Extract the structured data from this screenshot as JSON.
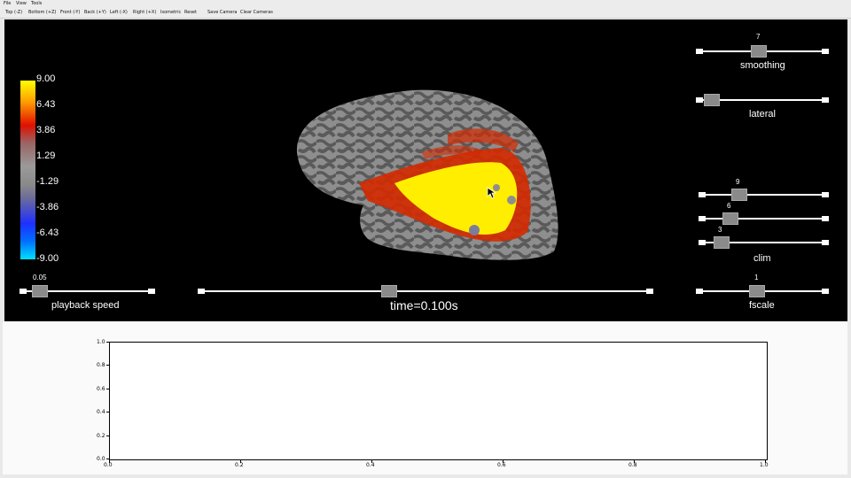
{
  "menu": {
    "file": "File",
    "view": "View",
    "tools": "Tools"
  },
  "toolbar": {
    "top": "Top (-Z)",
    "bottom": "Bottom (+Z)",
    "front": "Front (-Y)",
    "back": "Back (+Y)",
    "left": "Left (-X)",
    "right": "Right (+X)",
    "isometric": "Isometric",
    "reset": "Reset",
    "save_camera": "Save Camera",
    "clear_cameras": "Clear Cameras"
  },
  "colorbar": {
    "ticks": [
      "9.00",
      "6.43",
      "3.86",
      "1.29",
      "-1.29",
      "-3.86",
      "-6.43",
      "-9.00"
    ]
  },
  "sliders": {
    "smoothing": {
      "label": "smoothing",
      "value": "7"
    },
    "lateral": {
      "label": "lateral"
    },
    "clim_high": {
      "value": "9"
    },
    "clim_mid": {
      "value": "6"
    },
    "clim_low": {
      "value": "3"
    },
    "clim": {
      "label": "clim"
    },
    "playback": {
      "label": "playback speed",
      "value": "0.05"
    },
    "time": {
      "label": "time=0.100s"
    },
    "fscale": {
      "label": "fscale",
      "value": "1"
    }
  },
  "plot": {
    "yticks": [
      "1.0",
      "0.8",
      "0.6",
      "0.4",
      "0.2",
      "0.0"
    ],
    "xticks": [
      "0.0",
      "0.2",
      "0.4",
      "0.6",
      "0.8",
      "1.0"
    ]
  },
  "colors": {
    "hot": "#ffee00",
    "warm": "#e62a00",
    "cool": "#1d3cff",
    "surface": "#8c8c8c"
  }
}
